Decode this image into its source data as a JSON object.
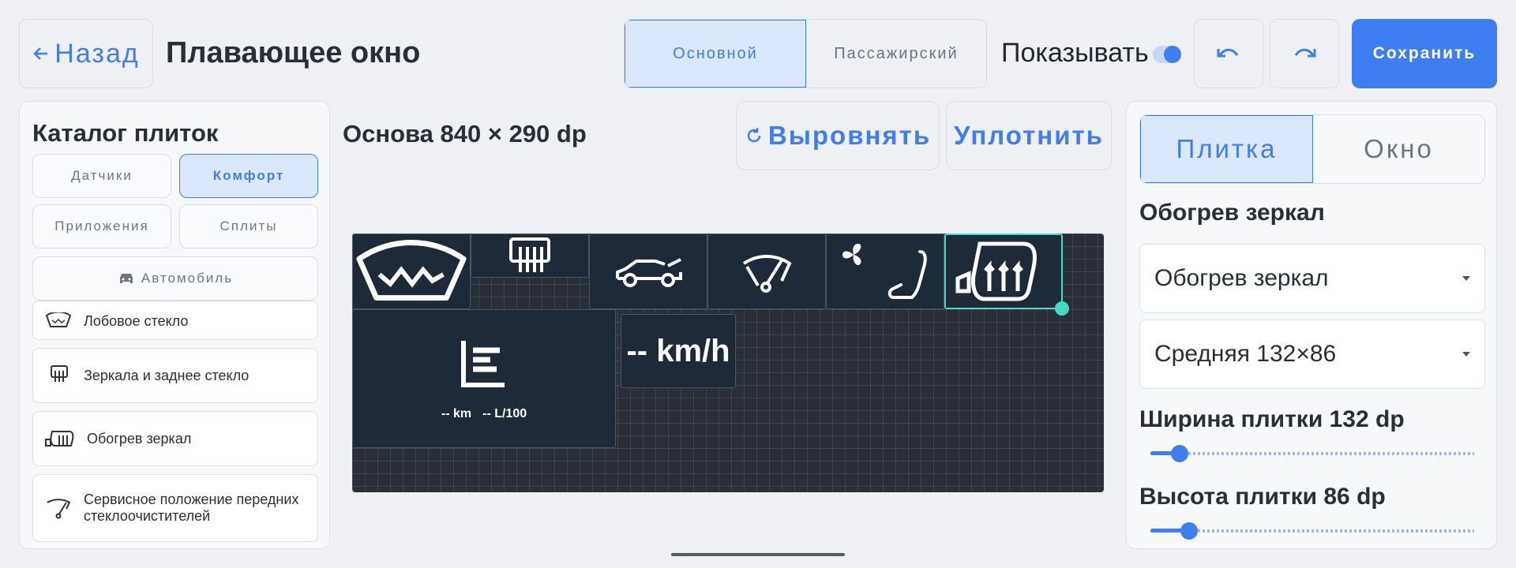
{
  "header": {
    "back_label": "Назад",
    "title": "Плавающее окно",
    "tabs": [
      {
        "label": "Основной",
        "active": true
      },
      {
        "label": "Пассажирский",
        "active": false
      }
    ],
    "show_label": "Показывать",
    "show_enabled": true,
    "undo_icon": "undo-icon",
    "redo_icon": "redo-icon",
    "save_label": "Сохранить"
  },
  "catalog": {
    "title": "Каталог плиток",
    "chips": [
      {
        "label": "Датчики",
        "active": false
      },
      {
        "label": "Комфорт",
        "active": true
      },
      {
        "label": "Приложения",
        "active": false
      },
      {
        "label": "Сплиты",
        "active": false
      },
      {
        "label": "Автомобиль",
        "active": false,
        "icon": "car-icon"
      }
    ],
    "items": [
      {
        "label": "Лобовое стекло",
        "icon": "windshield-icon"
      },
      {
        "label": "Зеркала и заднее стекло",
        "icon": "rear-defrost-icon"
      },
      {
        "label": "Обогрев зеркал",
        "icon": "mirror-heat-icon"
      },
      {
        "label": "Сервисное положение передних стеклоочистителей",
        "icon": "wiper-service-icon"
      }
    ]
  },
  "canvas": {
    "base_label": "Основа 840 × 290 dp",
    "align_label": "Выровнять",
    "compact_label": "Уплотнить",
    "tiles": {
      "speed": "-- km/h",
      "trip_km": "-- km",
      "trip_fuel": "-- L/100"
    }
  },
  "inspector": {
    "tabs": [
      {
        "label": "Плитка",
        "active": true
      },
      {
        "label": "Окно",
        "active": false
      }
    ],
    "tile_name": "Обогрев зеркал",
    "tile_select": "Обогрев зеркал",
    "size_select": "Средняя 132×86",
    "width_label": "Ширина плитки 132 dp",
    "height_label": "Высота плитки 86 dp",
    "width_slider_fraction": 0.09,
    "height_slider_fraction": 0.12
  },
  "colors": {
    "accent": "#3f7df2",
    "selection": "#46d8c0",
    "tile_bg": "#1e2a38"
  }
}
